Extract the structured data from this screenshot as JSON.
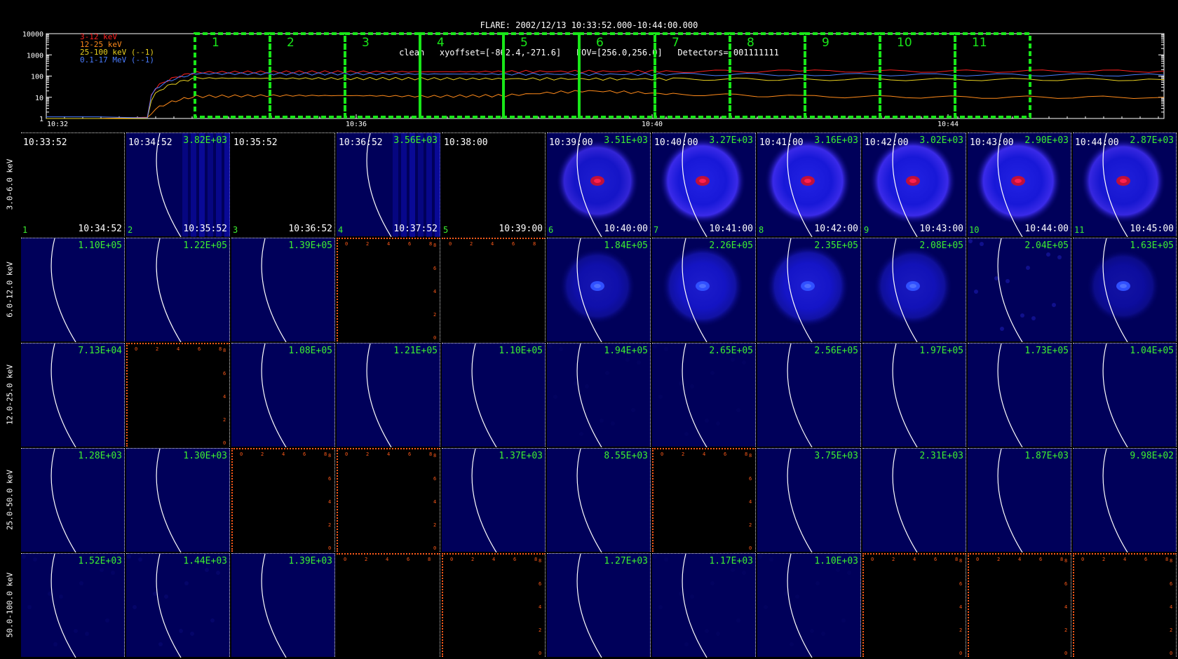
{
  "header": {
    "line1": "FLARE: 2002/12/13 10:33:52.000-10:44:00.000",
    "line2": "clean   xyoffset=[-862.4,-271.6]   FOV=[256.0,256.0]   Detectors= 001111111"
  },
  "chart_data": [
    {
      "type": "line",
      "x_ticks": [
        "10:32",
        "10:36",
        "10:40",
        "10:44"
      ],
      "y_ticks": [
        "1",
        "10",
        "100",
        "1000",
        "10000"
      ],
      "y_scale": "log",
      "ylim": [
        1,
        10000
      ],
      "legend_placement": "top-left",
      "series": [
        {
          "name": "3-12 keV",
          "color": "#ff2020",
          "values": [
            1,
            1,
            1,
            150,
            155,
            158,
            160,
            162,
            165,
            168,
            170,
            170,
            172
          ]
        },
        {
          "name": "12-25 keV",
          "color": "#ff8a1a",
          "values": [
            1,
            1,
            1,
            11,
            12,
            12,
            11,
            12,
            20,
            14,
            11,
            10,
            10
          ]
        },
        {
          "name": "25-100 keV (--1)",
          "color": "#e8d020",
          "values": [
            1,
            1,
            1,
            80,
            78,
            76,
            75,
            74,
            73,
            72,
            70,
            69,
            68
          ]
        },
        {
          "name": "0.1-17 MeV (--1)",
          "color": "#4a7cff",
          "values": [
            1.2,
            1.2,
            1.2,
            130,
            128,
            126,
            125,
            124,
            122,
            120,
            118,
            115,
            112
          ]
        }
      ],
      "intervals": [
        "1",
        "2",
        "3",
        "4",
        "5",
        "6",
        "7",
        "8",
        "9",
        "10",
        "11"
      ]
    },
    {
      "type": "heatmap",
      "row_labels": [
        "3.0-6.0 keV",
        "6.0-12.0 keV",
        "12.0-25.0 keV",
        "25.0-50.0 keV",
        "50.0-100.0 keV"
      ],
      "columns": [
        {
          "start": "10:33:52",
          "end": "10:34:52",
          "index": "1"
        },
        {
          "start": "10:34:52",
          "end": "10:35:52",
          "index": "2"
        },
        {
          "start": "10:35:52",
          "end": "10:36:52",
          "index": "3"
        },
        {
          "start": "10:36:52",
          "end": "10:37:52",
          "index": "4"
        },
        {
          "start": "10:38:00",
          "end": "10:39:00",
          "index": "5"
        },
        {
          "start": "10:39:00",
          "end": "10:40:00",
          "index": "6"
        },
        {
          "start": "10:40:00",
          "end": "10:41:00",
          "index": "7"
        },
        {
          "start": "10:41:00",
          "end": "10:42:00",
          "index": "8"
        },
        {
          "start": "10:42:00",
          "end": "10:43:00",
          "index": "9"
        },
        {
          "start": "10:43:00",
          "end": "10:44:00",
          "index": "10"
        },
        {
          "start": "10:44:00",
          "end": "10:45:00",
          "index": "11"
        }
      ],
      "panel_ticks": [
        "0",
        "2",
        "4",
        "6",
        "8"
      ],
      "peaks": [
        [
          "",
          "3.82E+03",
          "",
          "3.56E+03",
          "",
          "3.51E+03",
          "3.27E+03",
          "3.16E+03",
          "3.02E+03",
          "2.90E+03",
          "2.87E+03"
        ],
        [
          "1.10E+05",
          "1.22E+05",
          "1.39E+05",
          "",
          "",
          "1.84E+05",
          "2.26E+05",
          "2.35E+05",
          "2.08E+05",
          "2.04E+05",
          "1.63E+05"
        ],
        [
          "7.13E+04",
          "",
          "1.08E+05",
          "1.21E+05",
          "1.10E+05",
          "1.94E+05",
          "2.65E+05",
          "2.56E+05",
          "1.97E+05",
          "1.73E+05",
          "1.04E+05"
        ],
        [
          "1.28E+03",
          "1.30E+03",
          "",
          "",
          "1.37E+03",
          "8.55E+03",
          "",
          "3.75E+03",
          "2.31E+03",
          "1.87E+03",
          "9.98E+02"
        ],
        [
          "1.52E+03",
          "1.44E+03",
          "1.39E+03",
          "",
          "",
          "1.27E+03",
          "1.17E+03",
          "1.10E+03",
          "",
          "",
          ""
        ]
      ],
      "intensity": [
        [
          0,
          0.55,
          0,
          0.55,
          0,
          0.8,
          1.0,
          1.0,
          1.0,
          1.0,
          0.9
        ],
        [
          0,
          0,
          0,
          0,
          0,
          0.45,
          0.75,
          0.8,
          0.6,
          0.5,
          0.3
        ],
        [
          0,
          0,
          0,
          0,
          0,
          0.05,
          0.05,
          0,
          0,
          0,
          0
        ],
        [
          0,
          0,
          0,
          0,
          0,
          0,
          0,
          0,
          0,
          0,
          0
        ],
        [
          0.1,
          0.15,
          0,
          0,
          0,
          0,
          0.05,
          0.05,
          0,
          0,
          0
        ]
      ],
      "panel_type": [
        [
          "empty",
          "stripes",
          "empty",
          "stripes",
          "empty",
          "disk",
          "disk",
          "disk",
          "disk",
          "disk",
          "disk"
        ],
        [
          "blue",
          "blue",
          "blue",
          "axes",
          "axes-top",
          "disk",
          "disk",
          "disk",
          "disk",
          "blue",
          "disk"
        ],
        [
          "blue",
          "axes",
          "blue",
          "blue",
          "blue",
          "blue",
          "blue",
          "blue",
          "blue",
          "blue",
          "blue"
        ],
        [
          "blue",
          "blue",
          "axes",
          "axes",
          "blue",
          "blue",
          "axes",
          "blue",
          "blue",
          "blue",
          "blue"
        ],
        [
          "blue",
          "blue",
          "blue",
          "axes-top",
          "axes",
          "blue",
          "blue",
          "blue",
          "axes",
          "axes",
          "axes"
        ]
      ]
    }
  ]
}
